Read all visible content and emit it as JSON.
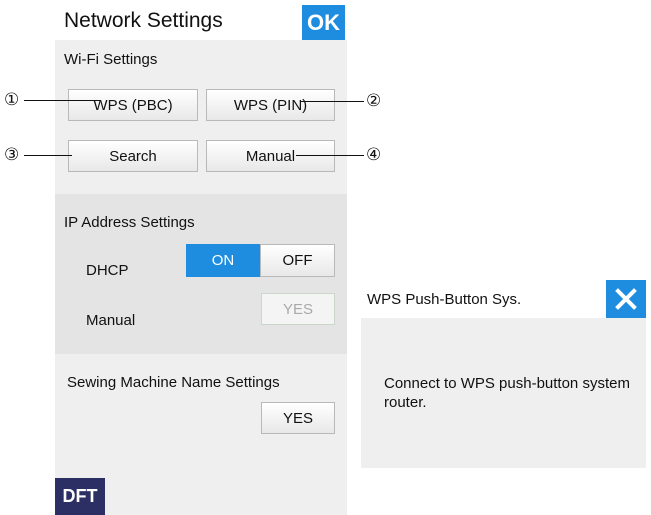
{
  "header": {
    "title": "Network Settings",
    "ok_label": "OK"
  },
  "wifi": {
    "section_label": "Wi-Fi Settings",
    "wps_pbc_label": "WPS (PBC)",
    "wps_pin_label": "WPS (PIN)",
    "search_label": "Search",
    "manual_label": "Manual"
  },
  "ip": {
    "section_label": "IP Address Settings",
    "dhcp_label": "DHCP",
    "on_label": "ON",
    "off_label": "OFF",
    "dhcp_value": "ON",
    "manual_label": "Manual",
    "yes_label": "YES"
  },
  "machine_name": {
    "section_label": "Sewing Machine Name Settings",
    "yes_label": "YES"
  },
  "footer": {
    "dft_label": "DFT"
  },
  "callouts": {
    "c1": "①",
    "c2": "②",
    "c3": "③",
    "c4": "④"
  },
  "dialog": {
    "title": "WPS Push-Button Sys.",
    "close_icon": "close-icon",
    "message": "Connect to WPS push-button system router."
  },
  "colors": {
    "accent": "#1e8de0",
    "dft": "#2b2f64",
    "panel_light": "#efefef",
    "panel_mid": "#e4e4e4"
  }
}
